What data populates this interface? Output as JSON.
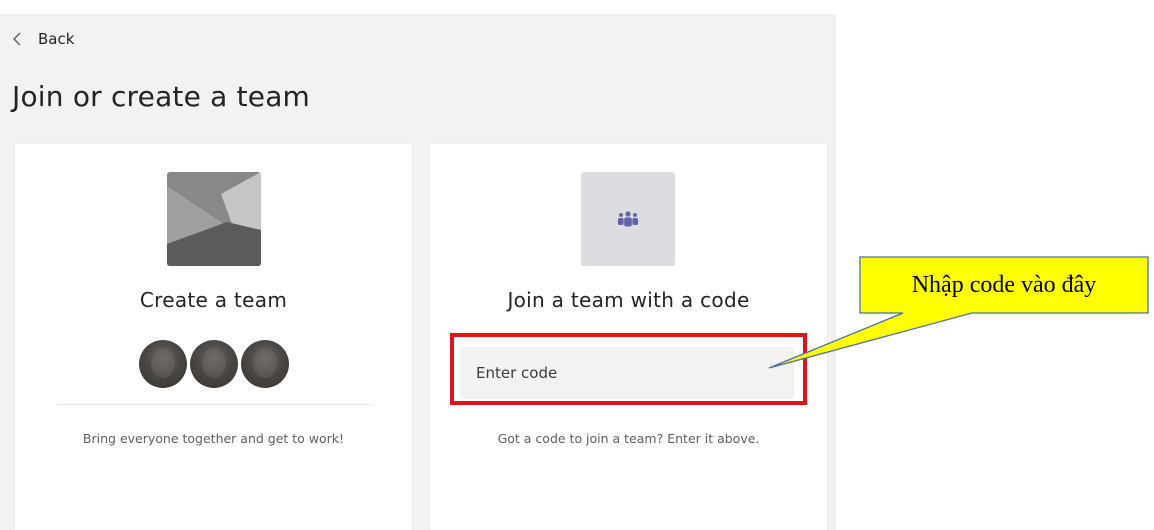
{
  "header": {
    "back_label": "Back",
    "title": "Join or create a team"
  },
  "create_card": {
    "title": "Create a team",
    "description": "Bring everyone together and get to work!",
    "image_icon": "landscape-placeholder-icon",
    "avatar_icon": "person-avatar-icon"
  },
  "join_card": {
    "title": "Join a team with a code",
    "input_placeholder": "Enter code",
    "input_value": "",
    "description": "Got a code to join a team? Enter it above.",
    "team_icon": "people-group-icon"
  },
  "annotation": {
    "callout_text": "Nhập code vào đây",
    "callout_fill": "#ffff00",
    "callout_border": "#4f6fa8",
    "highlight_color": "#e0131a"
  },
  "colors": {
    "app_background": "#f3f2f1",
    "card_background": "#ffffff",
    "team_icon_purple": "#6264a7",
    "text_primary": "#252423",
    "text_secondary": "#605e5c"
  }
}
